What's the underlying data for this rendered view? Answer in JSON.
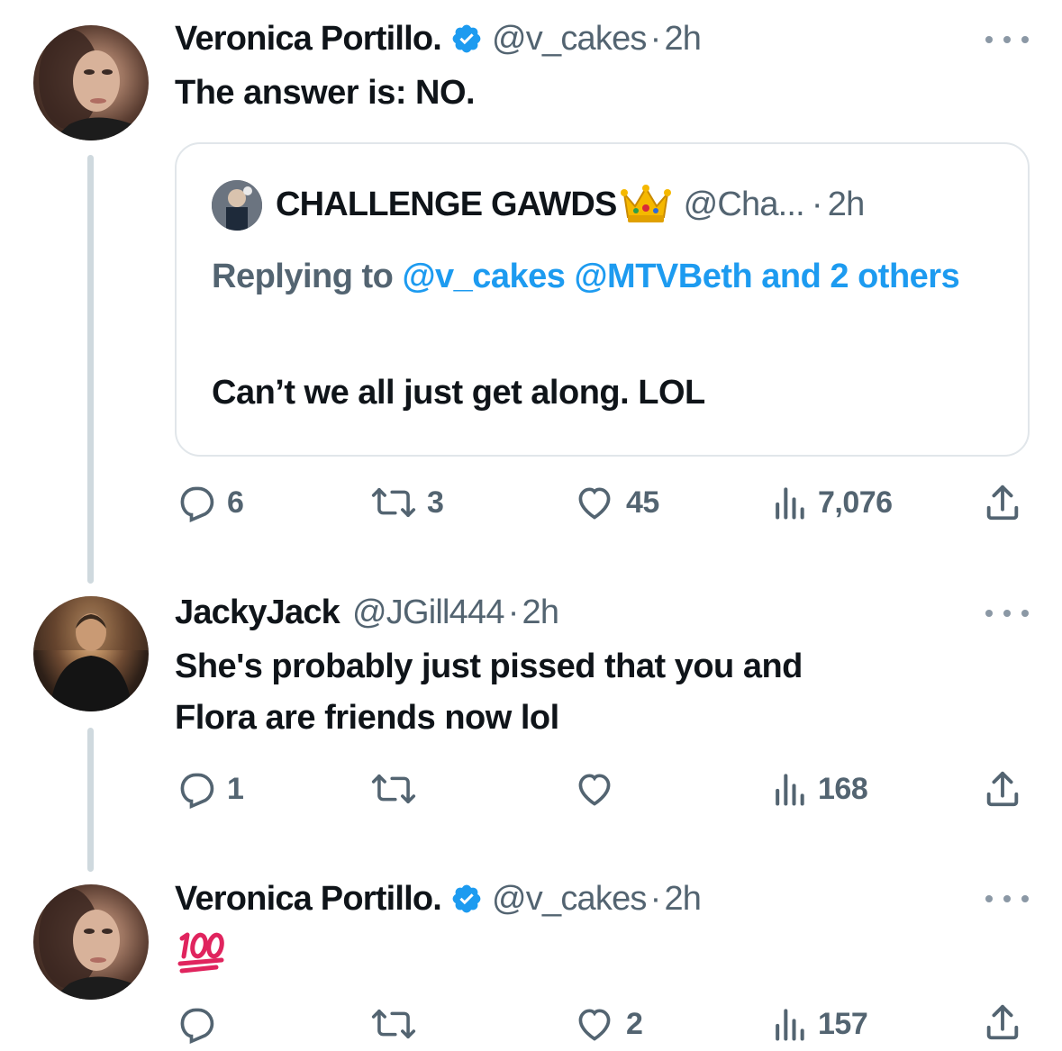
{
  "colors": {
    "text": "#0f1419",
    "secondary": "#536471",
    "link": "#1d9bf0",
    "thread": "#cfd9de",
    "border": "#e1e6ea"
  },
  "tweets": [
    {
      "name": "Veronica Portillo.",
      "handle": "@v_cakes",
      "time": "2h",
      "verified": true,
      "text": "The answer is: NO.",
      "quote": {
        "name": "CHALLENGE GAWDS",
        "name_emoji": "crown-emoji",
        "handle": "@Cha...",
        "time": "2h",
        "replying_prefix": "Replying to ",
        "replying_mentions": "@v_cakes @MTVBeth and 2 others",
        "text": "Can’t we all just get along. LOL"
      },
      "actions": {
        "replies": "6",
        "retweets": "3",
        "likes": "45",
        "views": "7,076"
      }
    },
    {
      "name": "JackyJack",
      "handle": "@JGill444",
      "time": "2h",
      "verified": false,
      "text_line1": "She's probably just pissed that you and",
      "text_line2": "Flora are friends now lol",
      "actions": {
        "replies": "1",
        "retweets": "",
        "likes": "",
        "views": "168"
      }
    },
    {
      "name": "Veronica Portillo.",
      "handle": "@v_cakes",
      "time": "2h",
      "verified": true,
      "text_emoji": "hundred-points-emoji",
      "actions": {
        "replies": "",
        "retweets": "",
        "likes": "2",
        "views": "157"
      }
    }
  ],
  "separator": "·"
}
